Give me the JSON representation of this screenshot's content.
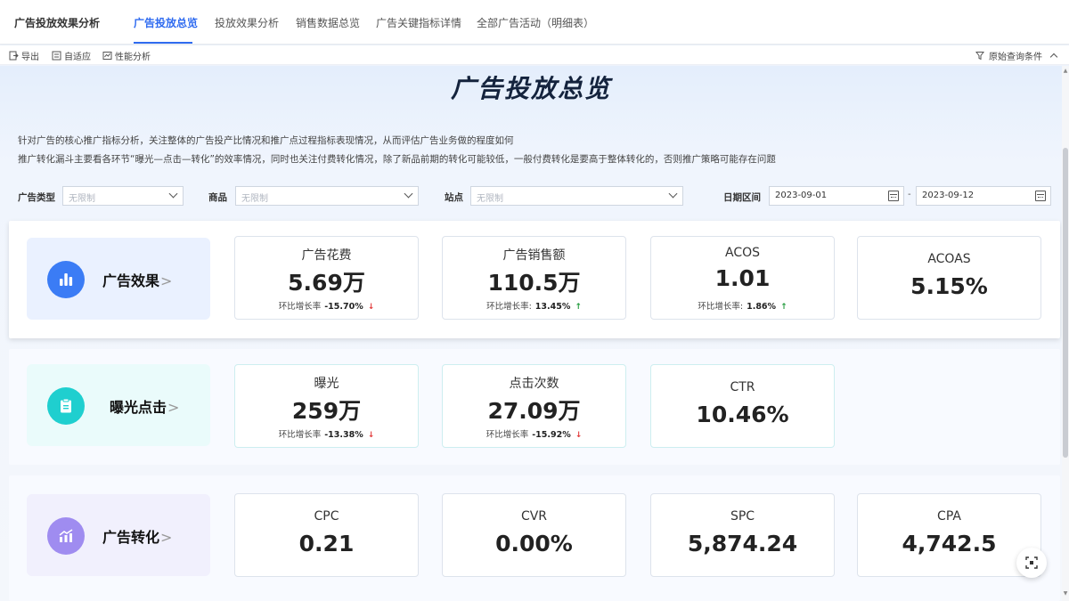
{
  "app": {
    "title": "广告投放效果分析"
  },
  "tabs": [
    {
      "label": "广告投放总览",
      "active": true
    },
    {
      "label": "投放效果分析"
    },
    {
      "label": "销售数据总览"
    },
    {
      "label": "广告关键指标详情"
    },
    {
      "label": "全部广告活动（明细表）"
    }
  ],
  "toolbar": {
    "export": "导出",
    "adapt": "自适应",
    "perf": "性能分析",
    "query": "原始查询条件"
  },
  "page": {
    "title": "广告投放总览",
    "desc1": "针对广告的核心推广指标分析，关注整体的广告投产比情况和推广点过程指标表现情况，从而评估广告业务做的程度如何",
    "desc2": "推广转化漏斗主要看各环节“曝光—点击—转化”的效率情况，同时也关注付费转化情况，除了新品前期的转化可能较低，一般付费转化是要高于整体转化的，否则推广策略可能存在问题"
  },
  "filters": {
    "ad_type": {
      "label": "广告类型",
      "value": "无限制"
    },
    "product": {
      "label": "商品",
      "value": "无限制"
    },
    "site": {
      "label": "站点",
      "value": "无限制"
    },
    "date": {
      "label": "日期区间",
      "start": "2023-09-01",
      "sep": "-",
      "end": "2023-09-12"
    }
  },
  "growth_label": "环比增长率",
  "growth_label_colon": "环比增长率:",
  "sections": {
    "effect": {
      "label": "广告效果",
      "gt": ">",
      "metrics": [
        {
          "name": "广告花费",
          "value": "5.69万",
          "growth": "-15.70%",
          "trend": "down"
        },
        {
          "name": "广告销售额",
          "value": "110.5万",
          "growth": "13.45%",
          "trend": "up"
        },
        {
          "name": "ACOS",
          "value": "1.01",
          "growth": "1.86%",
          "trend": "up"
        },
        {
          "name": "ACOAS",
          "value": "5.15%"
        }
      ]
    },
    "exposure": {
      "label": "曝光点击",
      "gt": ">",
      "metrics": [
        {
          "name": "曝光",
          "value": "259万",
          "growth": "-13.38%",
          "trend": "down"
        },
        {
          "name": "点击次数",
          "value": "27.09万",
          "growth": "-15.92%",
          "trend": "down"
        },
        {
          "name": "CTR",
          "value": "10.46%"
        }
      ]
    },
    "conversion": {
      "label": "广告转化",
      "gt": ">",
      "metrics": [
        {
          "name": "CPC",
          "value": "0.21"
        },
        {
          "name": "CVR",
          "value": "0.00%"
        },
        {
          "name": "SPC",
          "value": "5,874.24"
        },
        {
          "name": "CPA",
          "value": "4,742.5"
        }
      ]
    }
  },
  "colors": {
    "accent": "#2f6bf0",
    "down": "#e23b3b",
    "up": "#1f9a3a"
  }
}
